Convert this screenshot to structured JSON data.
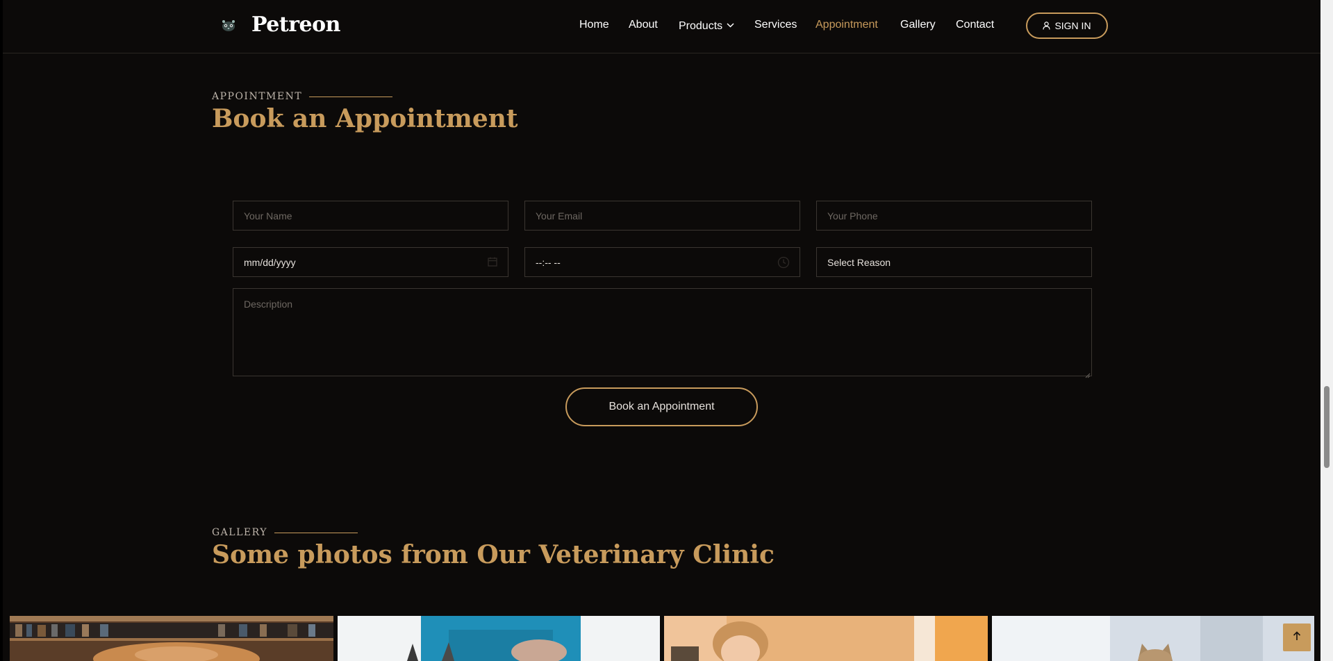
{
  "header": {
    "brand": "Petreon",
    "nav": [
      {
        "label": "Home",
        "active": false
      },
      {
        "label": "About",
        "active": false
      },
      {
        "label": "Products",
        "active": false
      },
      {
        "label": "Services",
        "active": false
      },
      {
        "label": "Appointment",
        "active": true
      },
      {
        "label": "Gallery",
        "active": false
      },
      {
        "label": "Contact",
        "active": false
      }
    ],
    "signin_label": "SIGN IN"
  },
  "appointment": {
    "eyebrow": "APPOINTMENT",
    "title": "Book an Appointment",
    "form": {
      "name_placeholder": "Your Name",
      "email_placeholder": "Your Email",
      "phone_placeholder": "Your Phone",
      "date_value": "mm/dd/yyyy",
      "time_value": "--:-- --",
      "reason_value": "Select Reason",
      "description_placeholder": "Description"
    },
    "submit_label": "Book an Appointment"
  },
  "gallery": {
    "eyebrow": "GALLERY",
    "title": "Some photos from Our Veterinary Clinic"
  },
  "colors": {
    "background": "#0c0a09",
    "accent": "#c89b5c",
    "text": "#ffffff"
  },
  "icons": {
    "logo": "paw-icon",
    "products_dropdown": "chevron-down-icon",
    "signin": "user-icon",
    "date": "calendar-icon",
    "time": "clock-icon",
    "scroll_top": "arrow-up-icon"
  }
}
